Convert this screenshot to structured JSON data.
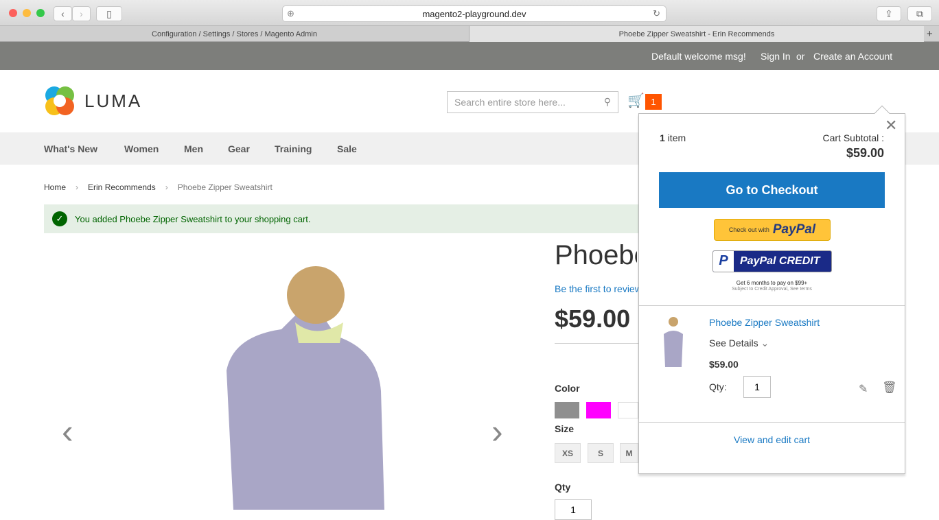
{
  "browser": {
    "url": "magento2-playground.dev",
    "tabs": [
      {
        "label": "Configuration / Settings / Stores / Magento Admin"
      },
      {
        "label": "Phoebe Zipper Sweatshirt - Erin Recommends"
      }
    ]
  },
  "header": {
    "welcome": "Default welcome msg!",
    "sign_in": "Sign In",
    "or": "or",
    "create_account": "Create an Account"
  },
  "logo": {
    "text": "LUMA"
  },
  "search": {
    "placeholder": "Search entire store here..."
  },
  "cart": {
    "count": "1",
    "accent": "#ff5501"
  },
  "nav": [
    "What's New",
    "Women",
    "Men",
    "Gear",
    "Training",
    "Sale"
  ],
  "breadcrumb": [
    "Home",
    "Erin Recommends",
    "Phoebe Zipper Sweatshirt"
  ],
  "message": "You added Phoebe Zipper Sweatshirt to your shopping cart.",
  "product": {
    "title": "Phoebe Zipper Sweatshirt",
    "review": "Be the first to review this product",
    "price": "$59.00",
    "color_label": "Color",
    "size_label": "Size",
    "qty_label": "Qty",
    "colors": [
      "#8f8f8f",
      "#ff00ff",
      "#ffffff"
    ],
    "sizes": [
      "XS",
      "S",
      "M"
    ],
    "qty": "1"
  },
  "minicart": {
    "count": "1",
    "item_word": "item",
    "subtotal_label": "Cart Subtotal :",
    "subtotal": "$59.00",
    "checkout": "Go to Checkout",
    "paypal_prefix": "Check out with",
    "paypal": "PayPal",
    "paypal_credit": "PayPal CREDIT",
    "credit_line1": "Get 6 months to pay on $99+",
    "credit_line2": "Subject to Credit Approval, See terms",
    "item": {
      "name": "Phoebe Zipper Sweatshirt",
      "details": "See Details",
      "price": "$59.00",
      "qty_label": "Qty:",
      "qty": "1"
    },
    "view_cart": "View and edit cart",
    "button_color": "#1979c3"
  }
}
